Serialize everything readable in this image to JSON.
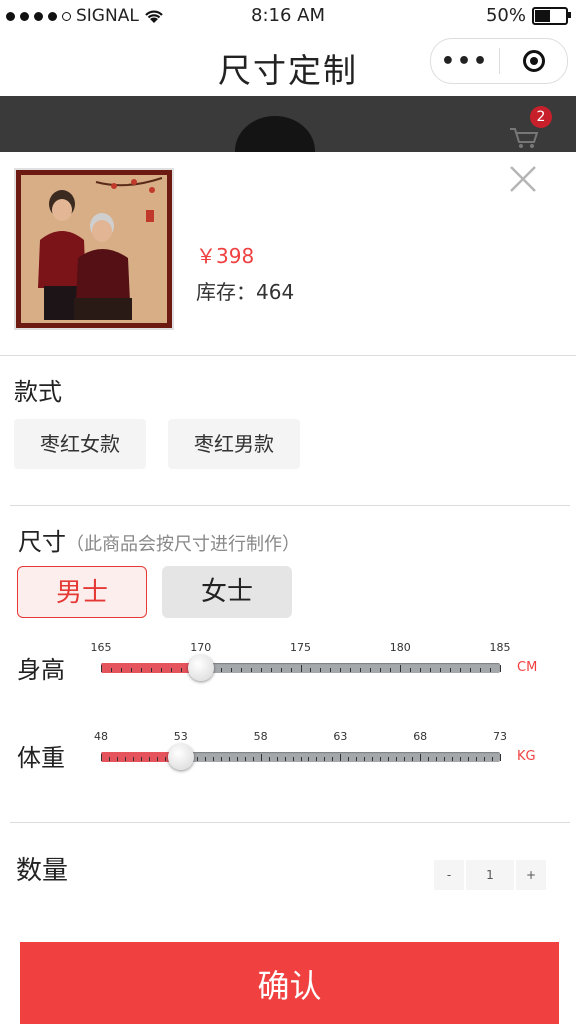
{
  "status_bar": {
    "carrier": "SIGNAL",
    "time": "8:16 AM",
    "battery": "50%"
  },
  "navbar": {
    "title": "尺寸定制",
    "more_label": "•••"
  },
  "cart": {
    "badge_count": "2"
  },
  "product": {
    "price": "￥398",
    "stock_label": "库存：464"
  },
  "style_section": {
    "title": "款式",
    "options": [
      "枣红女款",
      "枣红男款"
    ]
  },
  "size_section": {
    "title": "尺寸",
    "hint": "（此商品会按尺寸进行制作）",
    "genders": [
      "男士",
      "女士"
    ],
    "selected_gender": "男士"
  },
  "height_slider": {
    "label": "身高",
    "unit": "CM",
    "ticks": [
      "165",
      "170",
      "175",
      "180",
      "185"
    ],
    "min": 165,
    "max": 185,
    "value": 170
  },
  "weight_slider": {
    "label": "体重",
    "unit": "KG",
    "ticks": [
      "48",
      "53",
      "58",
      "63",
      "68",
      "73"
    ],
    "min": 48,
    "max": 73,
    "value": 53
  },
  "quantity": {
    "label": "数量",
    "minus": "-",
    "value": "1",
    "plus": "+"
  },
  "confirm_label": "确认",
  "colors": {
    "accent": "#f04040",
    "selected_border": "#e53935",
    "slider_fill": "#e5535d",
    "track": "#a4a8aa"
  }
}
